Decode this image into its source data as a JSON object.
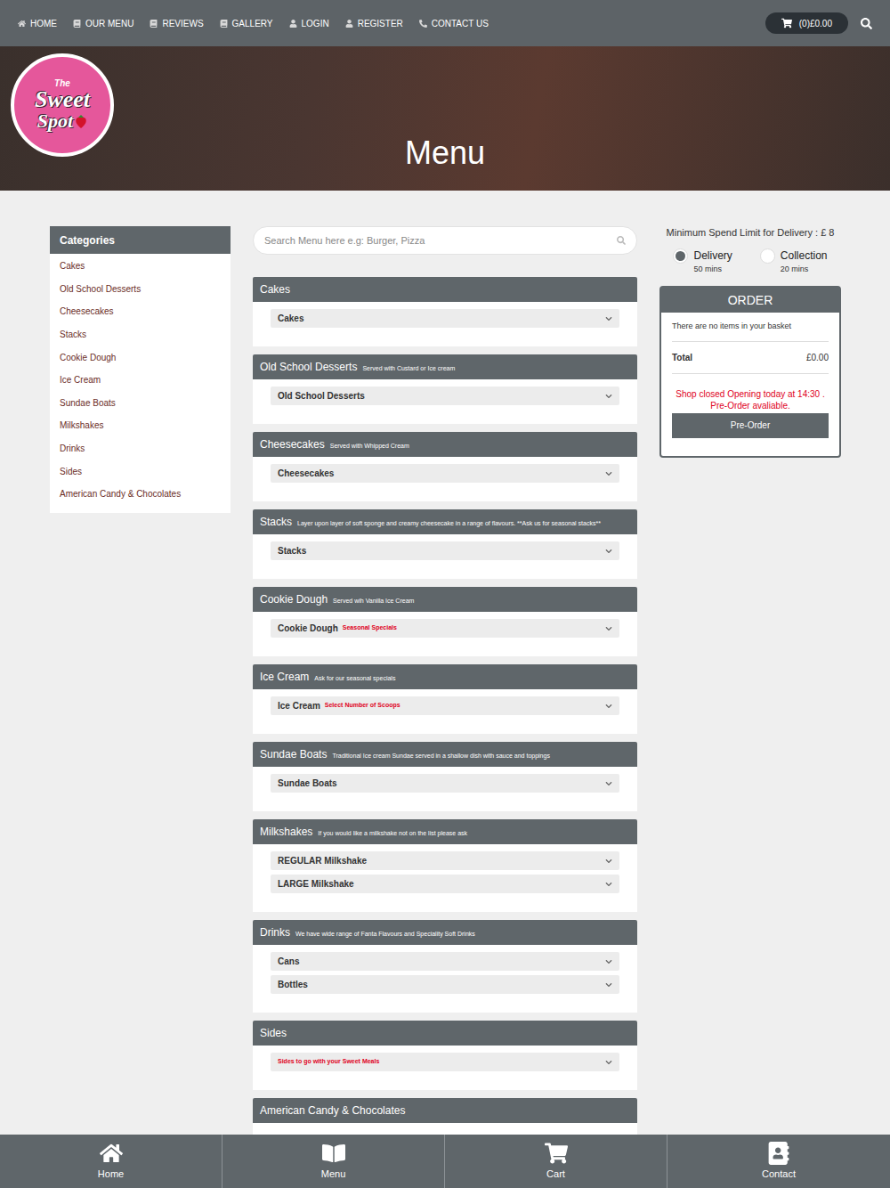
{
  "nav": {
    "items": [
      "HOME",
      "OUR MENU",
      "REVIEWS",
      "GALLERY",
      "LOGIN",
      "REGISTER",
      "CONTACT US"
    ],
    "cart": "(0)£0.00"
  },
  "logo": {
    "lines": [
      "The",
      "Sweet",
      "Spot"
    ]
  },
  "hero": {
    "title": "Menu"
  },
  "sidebar": {
    "title": "Categories",
    "items": [
      "Cakes",
      "Old School Desserts",
      "Cheesecakes",
      "Stacks",
      "Cookie Dough",
      "Ice Cream",
      "Sundae Boats",
      "Milkshakes",
      "Drinks",
      "Sides",
      "American Candy & Chocolates"
    ]
  },
  "search": {
    "placeholder": "Search Menu here e.g: Burger, Pizza"
  },
  "sections": [
    {
      "title": "Cakes",
      "subtitle": "",
      "rows": [
        {
          "label": "Cakes",
          "note": ""
        }
      ]
    },
    {
      "title": "Old School Desserts",
      "subtitle": "Served with Custard or Ice cream",
      "rows": [
        {
          "label": "Old School Desserts",
          "note": ""
        }
      ]
    },
    {
      "title": "Cheesecakes",
      "subtitle": "Served with Whipped Cream",
      "rows": [
        {
          "label": "Cheesecakes",
          "note": ""
        }
      ]
    },
    {
      "title": "Stacks",
      "subtitle": "Layer upon layer of soft sponge and creamy cheesecake in a range of flavours. **Ask us for seasonal stacks**",
      "rows": [
        {
          "label": "Stacks",
          "note": ""
        }
      ]
    },
    {
      "title": "Cookie Dough",
      "subtitle": "Served wih Vanilla Ice Cream",
      "rows": [
        {
          "label": "Cookie Dough",
          "note": "Seasonal Specials"
        }
      ]
    },
    {
      "title": "Ice Cream",
      "subtitle": "Ask for our seasonal specials",
      "rows": [
        {
          "label": "Ice Cream",
          "note": "Select Number of Scoops"
        }
      ]
    },
    {
      "title": "Sundae Boats",
      "subtitle": "Traditional Ice cream Sundae served in a shallow dish with sauce and toppings",
      "rows": [
        {
          "label": "Sundae Boats",
          "note": ""
        }
      ]
    },
    {
      "title": "Milkshakes",
      "subtitle": "If you would like a milkshake not on the list please ask",
      "rows": [
        {
          "label": "REGULAR Milkshake",
          "note": ""
        },
        {
          "label": "LARGE Milkshake",
          "note": ""
        }
      ]
    },
    {
      "title": "Drinks",
      "subtitle": "We have wide range of Fanta Flavours and Speciality Soft Drinks",
      "rows": [
        {
          "label": "Cans",
          "note": ""
        },
        {
          "label": "Bottles",
          "note": ""
        }
      ]
    },
    {
      "title": "Sides",
      "subtitle": "",
      "rows": [
        {
          "label": "",
          "note": "Sides to go with your Sweet Meals"
        }
      ]
    },
    {
      "title": "American Candy & Chocolates",
      "subtitle": "",
      "rows": []
    }
  ],
  "order": {
    "min_spend": "Minimum Spend Limit for Delivery : £ 8",
    "options": [
      {
        "label": "Delivery",
        "time": "50 mins",
        "selected": true
      },
      {
        "label": "Collection",
        "time": "20 mins",
        "selected": false
      }
    ],
    "title": "ORDER",
    "empty": "There are no items in your basket",
    "total_label": "Total",
    "total_value": "£0.00",
    "notice": [
      "Shop closed Opening today at 14:30 .",
      "Pre-Order avaliable."
    ],
    "button": "Pre-Order"
  },
  "bottom_nav": [
    "Home",
    "Menu",
    "Cart",
    "Contact"
  ]
}
